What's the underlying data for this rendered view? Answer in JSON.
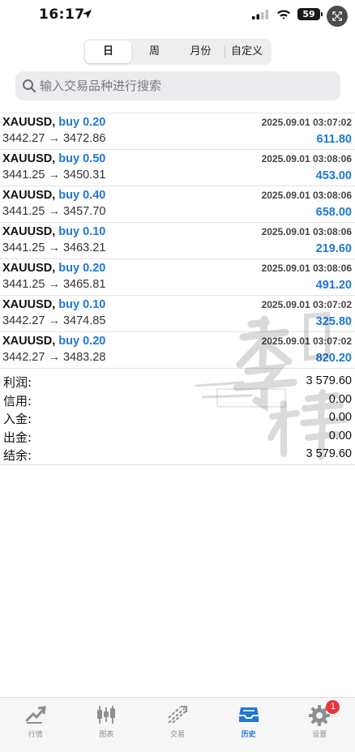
{
  "status_bar": {
    "time": "16:17",
    "battery": "59"
  },
  "period_tabs": [
    {
      "label": "日",
      "active": true
    },
    {
      "label": "周",
      "active": false
    },
    {
      "label": "月份",
      "active": false
    },
    {
      "label": "自定义",
      "active": false
    }
  ],
  "search": {
    "placeholder": "输入交易品种进行搜索"
  },
  "trades": [
    {
      "symbol": "XAUUSD,",
      "side": "buy 0.20",
      "date": "2025.09.01 03:07:02",
      "prices": "3442.27 → 3472.86",
      "profit": "611.80"
    },
    {
      "symbol": "XAUUSD,",
      "side": "buy 0.50",
      "date": "2025.09.01 03:08:06",
      "prices": "3441.25 → 3450.31",
      "profit": "453.00"
    },
    {
      "symbol": "XAUUSD,",
      "side": "buy 0.40",
      "date": "2025.09.01 03:08:06",
      "prices": "3441.25 → 3457.70",
      "profit": "658.00"
    },
    {
      "symbol": "XAUUSD,",
      "side": "buy 0.10",
      "date": "2025.09.01 03:08:06",
      "prices": "3441.25 → 3463.21",
      "profit": "219.60"
    },
    {
      "symbol": "XAUUSD,",
      "side": "buy 0.20",
      "date": "2025.09.01 03:08:06",
      "prices": "3441.25 → 3465.81",
      "profit": "491.20"
    },
    {
      "symbol": "XAUUSD,",
      "side": "buy 0.10",
      "date": "2025.09.01 03:07:02",
      "prices": "3442.27 → 3474.85",
      "profit": "325.80"
    },
    {
      "symbol": "XAUUSD,",
      "side": "buy 0.20",
      "date": "2025.09.01 03:07:02",
      "prices": "3442.27 → 3483.28",
      "profit": "820.20"
    }
  ],
  "summary": [
    {
      "label": "利润:",
      "value": "3 579.60"
    },
    {
      "label": "信用:",
      "value": "0.00"
    },
    {
      "label": "入金:",
      "value": "0.00"
    },
    {
      "label": "出金:",
      "value": "0.00"
    },
    {
      "label": "结余:",
      "value": "3 579.60"
    }
  ],
  "watermark": "李 楼",
  "tabbar": {
    "items": [
      {
        "label": "行情",
        "icon": "quotes-icon",
        "active": false
      },
      {
        "label": "图表",
        "icon": "chart-candles-icon",
        "active": false
      },
      {
        "label": "交易",
        "icon": "trade-icon",
        "active": false
      },
      {
        "label": "历史",
        "icon": "history-icon",
        "active": true
      },
      {
        "label": "设置",
        "icon": "settings-gear-icon",
        "active": false
      }
    ],
    "settings_badge": "1"
  },
  "colors": {
    "accent": "#1e78d6",
    "badge": "#e8333c"
  }
}
